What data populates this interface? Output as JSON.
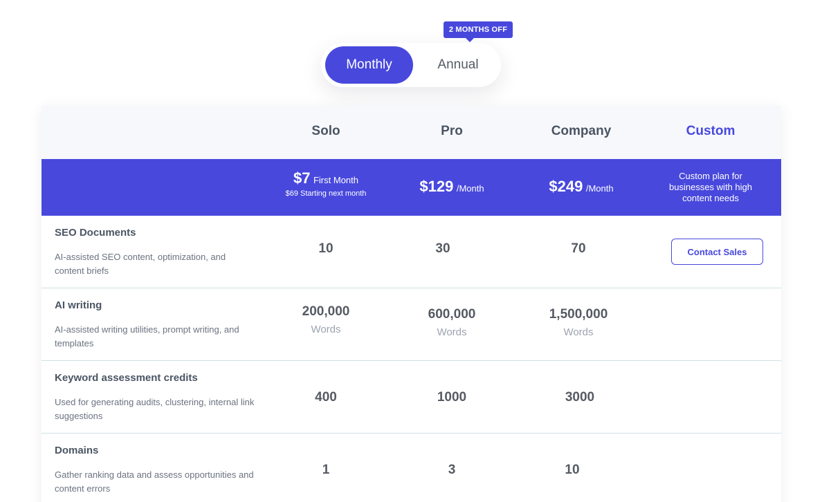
{
  "billing": {
    "monthly_label": "Monthly",
    "annual_label": "Annual",
    "promo_badge": "2 MONTHS OFF"
  },
  "plans": [
    {
      "name": "Solo",
      "price": "$7",
      "price_unit": "First Month",
      "price_note": "$69 Starting next month"
    },
    {
      "name": "Pro",
      "price": "$129",
      "price_unit": "/Month"
    },
    {
      "name": "Company",
      "price": "$249",
      "price_unit": "/Month"
    },
    {
      "name": "Custom",
      "description": "Custom plan for businesses with high content needs"
    }
  ],
  "features": [
    {
      "title": "SEO Documents",
      "description": "AI-assisted SEO content, optimization, and content briefs",
      "values": [
        "10",
        "30",
        "70"
      ]
    },
    {
      "title": "AI writing",
      "description": "AI-assisted writing utilities, prompt writing, and templates",
      "values": [
        "200,000",
        "600,000",
        "1,500,000"
      ],
      "unit": "Words"
    },
    {
      "title": "Keyword assessment credits",
      "description": "Used for generating audits, clustering, internal link suggestions",
      "values": [
        "400",
        "1000",
        "3000"
      ]
    },
    {
      "title": "Domains",
      "description": "Gather ranking data and assess opportunities and content errors",
      "values": [
        "1",
        "3",
        "10"
      ]
    }
  ],
  "custom_cta": "Contact Sales",
  "colors": {
    "accent": "#4848dd",
    "header_bg": "#f7f8fc",
    "row_divider": "#cfe0e4"
  }
}
